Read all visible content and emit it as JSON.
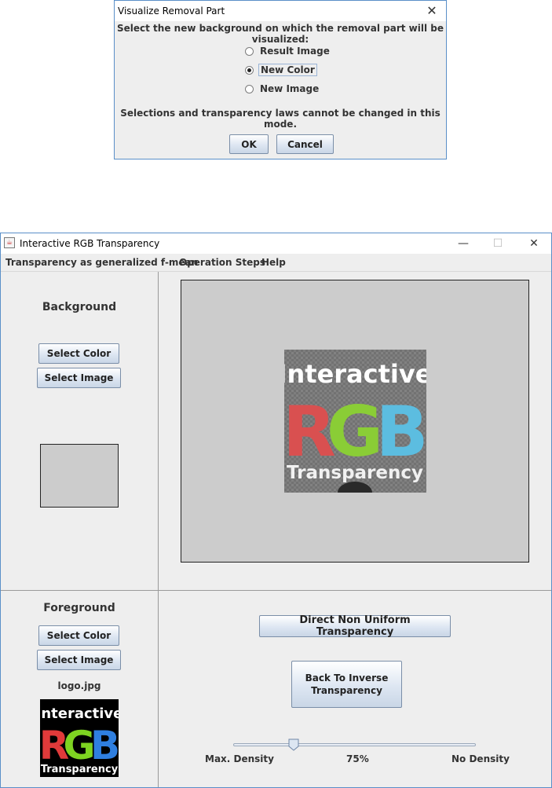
{
  "dialog": {
    "title": "Visualize Removal Part",
    "close_glyph": "✕",
    "prompt": "Select the new background on which the removal part will be visualized:",
    "options": [
      {
        "label": "Result Image",
        "checked": false
      },
      {
        "label": "New Color",
        "checked": true
      },
      {
        "label": "New Image",
        "checked": false
      }
    ],
    "note": "Selections and transparency laws cannot be changed in this mode.",
    "ok_label": "OK",
    "cancel_label": "Cancel"
  },
  "window": {
    "title": "Interactive RGB Transparency",
    "icon": "java-cup-icon",
    "minimize_glyph": "—",
    "maximize_glyph": "☐",
    "close_glyph": "✕",
    "menu": [
      "Transparency as generalized f-mean",
      "Operation Steps",
      "Help"
    ]
  },
  "background_panel": {
    "title": "Background",
    "select_color_label": "Select Color",
    "select_image_label": "Select Image",
    "swatch_color": "#cccccc"
  },
  "foreground_panel": {
    "title": "Foreground",
    "select_color_label": "Select Color",
    "select_image_label": "Select Image",
    "filename": "logo.jpg"
  },
  "logo": {
    "line1": "Interactive",
    "letters": [
      "R",
      "G",
      "B"
    ],
    "line3": "Transparency",
    "colors": {
      "r": "#e03a3a",
      "g": "#7ed321",
      "b": "#2f7fe0",
      "bg": "#000000"
    }
  },
  "preview_logo": {
    "colors": {
      "r": "#d95050",
      "g": "#8acd36",
      "b": "#5cbde0",
      "bg": "#7a7a7a"
    }
  },
  "controls": {
    "direct_button_label": "Direct Non Uniform Transparency",
    "back_button_label": "Back To Inverse Transparency",
    "slider_value": 0.25,
    "slider_min_label": "Max. Density",
    "slider_value_label": "75%",
    "slider_max_label": "No Density"
  }
}
